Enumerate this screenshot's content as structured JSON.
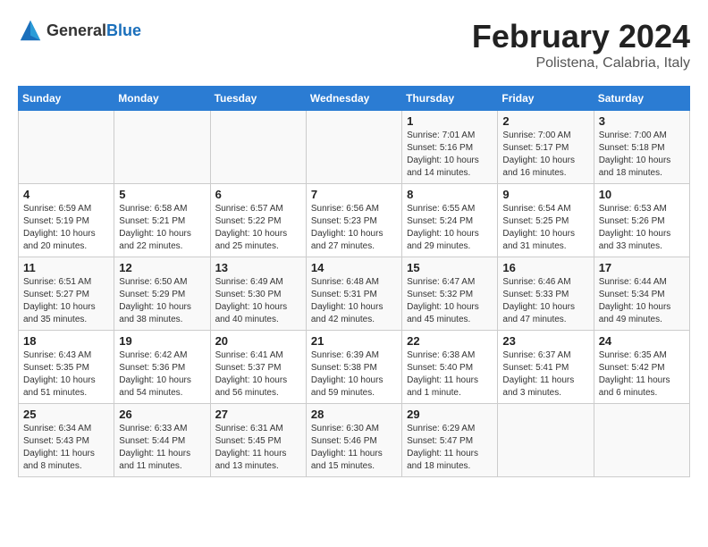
{
  "logo": {
    "text_general": "General",
    "text_blue": "Blue"
  },
  "header": {
    "month": "February 2024",
    "location": "Polistena, Calabria, Italy"
  },
  "weekdays": [
    "Sunday",
    "Monday",
    "Tuesday",
    "Wednesday",
    "Thursday",
    "Friday",
    "Saturday"
  ],
  "weeks": [
    [
      {
        "day": "",
        "sunrise": "",
        "sunset": "",
        "daylight": ""
      },
      {
        "day": "",
        "sunrise": "",
        "sunset": "",
        "daylight": ""
      },
      {
        "day": "",
        "sunrise": "",
        "sunset": "",
        "daylight": ""
      },
      {
        "day": "",
        "sunrise": "",
        "sunset": "",
        "daylight": ""
      },
      {
        "day": "1",
        "sunrise": "Sunrise: 7:01 AM",
        "sunset": "Sunset: 5:16 PM",
        "daylight": "Daylight: 10 hours and 14 minutes."
      },
      {
        "day": "2",
        "sunrise": "Sunrise: 7:00 AM",
        "sunset": "Sunset: 5:17 PM",
        "daylight": "Daylight: 10 hours and 16 minutes."
      },
      {
        "day": "3",
        "sunrise": "Sunrise: 7:00 AM",
        "sunset": "Sunset: 5:18 PM",
        "daylight": "Daylight: 10 hours and 18 minutes."
      }
    ],
    [
      {
        "day": "4",
        "sunrise": "Sunrise: 6:59 AM",
        "sunset": "Sunset: 5:19 PM",
        "daylight": "Daylight: 10 hours and 20 minutes."
      },
      {
        "day": "5",
        "sunrise": "Sunrise: 6:58 AM",
        "sunset": "Sunset: 5:21 PM",
        "daylight": "Daylight: 10 hours and 22 minutes."
      },
      {
        "day": "6",
        "sunrise": "Sunrise: 6:57 AM",
        "sunset": "Sunset: 5:22 PM",
        "daylight": "Daylight: 10 hours and 25 minutes."
      },
      {
        "day": "7",
        "sunrise": "Sunrise: 6:56 AM",
        "sunset": "Sunset: 5:23 PM",
        "daylight": "Daylight: 10 hours and 27 minutes."
      },
      {
        "day": "8",
        "sunrise": "Sunrise: 6:55 AM",
        "sunset": "Sunset: 5:24 PM",
        "daylight": "Daylight: 10 hours and 29 minutes."
      },
      {
        "day": "9",
        "sunrise": "Sunrise: 6:54 AM",
        "sunset": "Sunset: 5:25 PM",
        "daylight": "Daylight: 10 hours and 31 minutes."
      },
      {
        "day": "10",
        "sunrise": "Sunrise: 6:53 AM",
        "sunset": "Sunset: 5:26 PM",
        "daylight": "Daylight: 10 hours and 33 minutes."
      }
    ],
    [
      {
        "day": "11",
        "sunrise": "Sunrise: 6:51 AM",
        "sunset": "Sunset: 5:27 PM",
        "daylight": "Daylight: 10 hours and 35 minutes."
      },
      {
        "day": "12",
        "sunrise": "Sunrise: 6:50 AM",
        "sunset": "Sunset: 5:29 PM",
        "daylight": "Daylight: 10 hours and 38 minutes."
      },
      {
        "day": "13",
        "sunrise": "Sunrise: 6:49 AM",
        "sunset": "Sunset: 5:30 PM",
        "daylight": "Daylight: 10 hours and 40 minutes."
      },
      {
        "day": "14",
        "sunrise": "Sunrise: 6:48 AM",
        "sunset": "Sunset: 5:31 PM",
        "daylight": "Daylight: 10 hours and 42 minutes."
      },
      {
        "day": "15",
        "sunrise": "Sunrise: 6:47 AM",
        "sunset": "Sunset: 5:32 PM",
        "daylight": "Daylight: 10 hours and 45 minutes."
      },
      {
        "day": "16",
        "sunrise": "Sunrise: 6:46 AM",
        "sunset": "Sunset: 5:33 PM",
        "daylight": "Daylight: 10 hours and 47 minutes."
      },
      {
        "day": "17",
        "sunrise": "Sunrise: 6:44 AM",
        "sunset": "Sunset: 5:34 PM",
        "daylight": "Daylight: 10 hours and 49 minutes."
      }
    ],
    [
      {
        "day": "18",
        "sunrise": "Sunrise: 6:43 AM",
        "sunset": "Sunset: 5:35 PM",
        "daylight": "Daylight: 10 hours and 51 minutes."
      },
      {
        "day": "19",
        "sunrise": "Sunrise: 6:42 AM",
        "sunset": "Sunset: 5:36 PM",
        "daylight": "Daylight: 10 hours and 54 minutes."
      },
      {
        "day": "20",
        "sunrise": "Sunrise: 6:41 AM",
        "sunset": "Sunset: 5:37 PM",
        "daylight": "Daylight: 10 hours and 56 minutes."
      },
      {
        "day": "21",
        "sunrise": "Sunrise: 6:39 AM",
        "sunset": "Sunset: 5:38 PM",
        "daylight": "Daylight: 10 hours and 59 minutes."
      },
      {
        "day": "22",
        "sunrise": "Sunrise: 6:38 AM",
        "sunset": "Sunset: 5:40 PM",
        "daylight": "Daylight: 11 hours and 1 minute."
      },
      {
        "day": "23",
        "sunrise": "Sunrise: 6:37 AM",
        "sunset": "Sunset: 5:41 PM",
        "daylight": "Daylight: 11 hours and 3 minutes."
      },
      {
        "day": "24",
        "sunrise": "Sunrise: 6:35 AM",
        "sunset": "Sunset: 5:42 PM",
        "daylight": "Daylight: 11 hours and 6 minutes."
      }
    ],
    [
      {
        "day": "25",
        "sunrise": "Sunrise: 6:34 AM",
        "sunset": "Sunset: 5:43 PM",
        "daylight": "Daylight: 11 hours and 8 minutes."
      },
      {
        "day": "26",
        "sunrise": "Sunrise: 6:33 AM",
        "sunset": "Sunset: 5:44 PM",
        "daylight": "Daylight: 11 hours and 11 minutes."
      },
      {
        "day": "27",
        "sunrise": "Sunrise: 6:31 AM",
        "sunset": "Sunset: 5:45 PM",
        "daylight": "Daylight: 11 hours and 13 minutes."
      },
      {
        "day": "28",
        "sunrise": "Sunrise: 6:30 AM",
        "sunset": "Sunset: 5:46 PM",
        "daylight": "Daylight: 11 hours and 15 minutes."
      },
      {
        "day": "29",
        "sunrise": "Sunrise: 6:29 AM",
        "sunset": "Sunset: 5:47 PM",
        "daylight": "Daylight: 11 hours and 18 minutes."
      },
      {
        "day": "",
        "sunrise": "",
        "sunset": "",
        "daylight": ""
      },
      {
        "day": "",
        "sunrise": "",
        "sunset": "",
        "daylight": ""
      }
    ]
  ]
}
